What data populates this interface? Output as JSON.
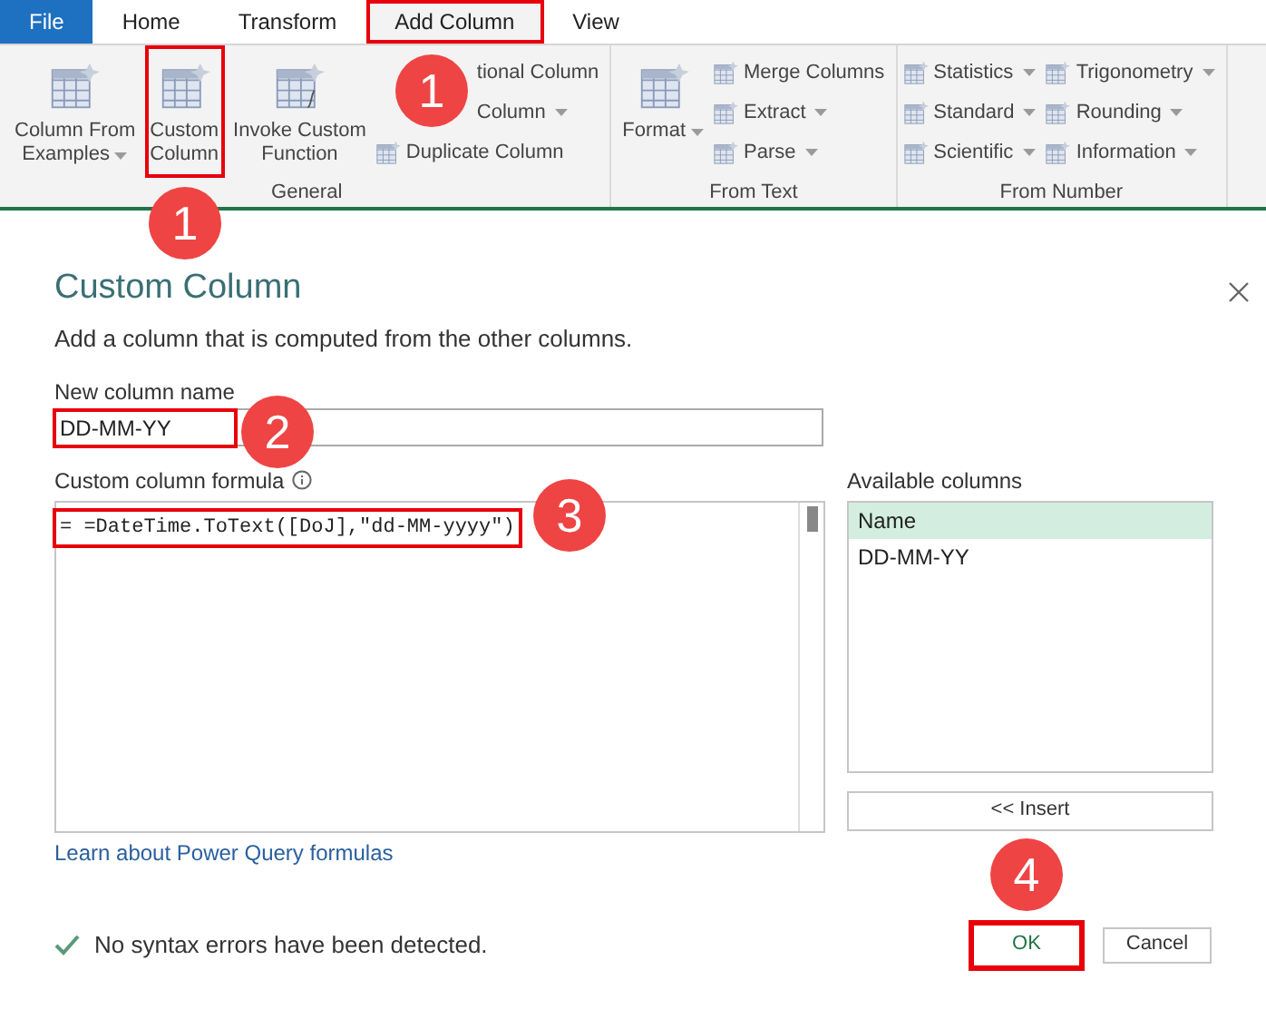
{
  "tabs": [
    {
      "label": "File",
      "kind": "file",
      "selected": false
    },
    {
      "label": "Home",
      "kind": "tab",
      "selected": false
    },
    {
      "label": "Transform",
      "kind": "tab",
      "selected": false
    },
    {
      "label": "Add Column",
      "kind": "tab",
      "selected": true
    },
    {
      "label": "View",
      "kind": "tab",
      "selected": false
    }
  ],
  "ribbon": {
    "groups": [
      {
        "title": "General",
        "large": [
          {
            "lines": [
              "Column From",
              "Examples"
            ],
            "dropdown": true,
            "selected": false
          },
          {
            "lines": [
              "Custom",
              "Column"
            ],
            "dropdown": false,
            "selected": true
          },
          {
            "lines": [
              "Invoke Custom",
              "Function"
            ],
            "dropdown": false,
            "selected": false
          }
        ],
        "small": [
          {
            "label": "tional Column",
            "dropdown": false,
            "covered": true
          },
          {
            "label": "Column",
            "dropdown": true,
            "covered": true
          },
          {
            "label": "Duplicate Column",
            "dropdown": false,
            "covered": false
          }
        ]
      },
      {
        "title": "From Text",
        "large": [
          {
            "lines": [
              "Format"
            ],
            "dropdown": true,
            "selected": false
          }
        ],
        "small": [
          {
            "label": "Merge Columns",
            "dropdown": false,
            "covered": false
          },
          {
            "label": "Extract",
            "dropdown": true,
            "covered": false
          },
          {
            "label": "Parse",
            "dropdown": true,
            "covered": false
          }
        ]
      },
      {
        "title": "From Number",
        "small": [
          {
            "label": "Statistics",
            "dropdown": true,
            "covered": false
          },
          {
            "label": "Standard",
            "dropdown": true,
            "covered": false
          },
          {
            "label": "Scientific",
            "dropdown": true,
            "covered": false
          },
          {
            "label": "Trigonometry",
            "dropdown": true,
            "covered": false
          },
          {
            "label": "Rounding",
            "dropdown": true,
            "covered": false
          },
          {
            "label": "Information",
            "dropdown": true,
            "covered": false
          }
        ]
      }
    ]
  },
  "dialog": {
    "title": "Custom Column",
    "description": "Add a column that is computed from the other columns.",
    "name_label": "New column name",
    "name_value": "DD-MM-YY",
    "formula_label": "Custom column formula",
    "formula": "= =DateTime.ToText([DoJ],\"dd-MM-yyyy\")",
    "available_label": "Available columns",
    "available_columns": [
      {
        "label": "Name",
        "selected": true
      },
      {
        "label": "DD-MM-YY",
        "selected": false
      }
    ],
    "insert_button": "<< Insert",
    "learn_link": "Learn about Power Query formulas",
    "status": "No syntax errors have been detected.",
    "buttons": [
      {
        "label": "OK",
        "kind": "primary"
      },
      {
        "label": "Cancel",
        "kind": "secondary"
      }
    ]
  },
  "callouts": [
    {
      "number": "1"
    },
    {
      "number": "1"
    },
    {
      "number": "2"
    },
    {
      "number": "3"
    },
    {
      "number": "4"
    }
  ]
}
